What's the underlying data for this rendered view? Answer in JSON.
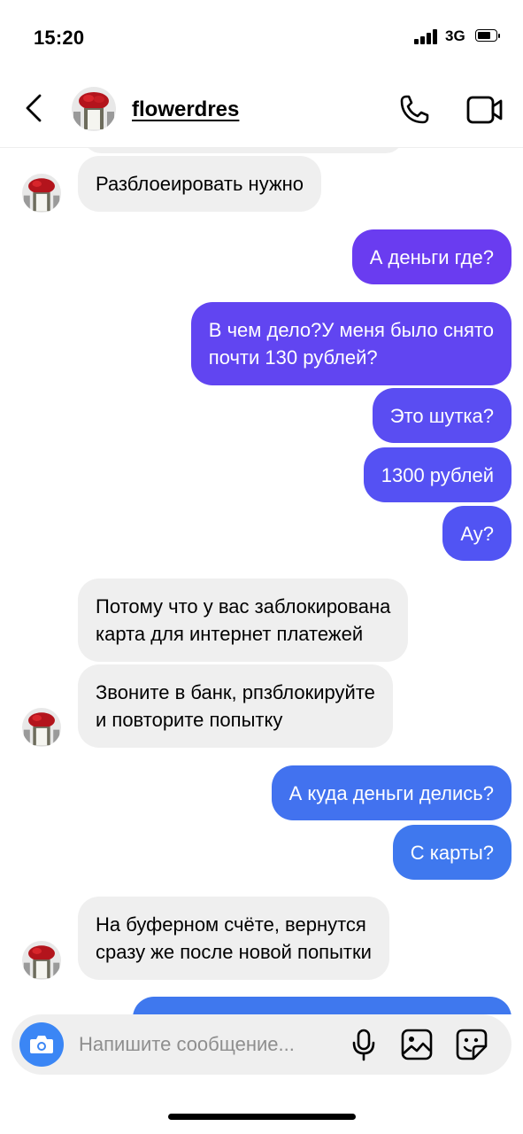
{
  "status_bar": {
    "time": "15:20",
    "network": "3G"
  },
  "header": {
    "username": "flowerdres"
  },
  "colors": {
    "sent_top": "#6a3cf0",
    "sent_mid": "#5150f3",
    "sent_bottom": "#3f78ee",
    "received": "#efefef",
    "camera": "#3b86f5"
  },
  "messages": [
    {
      "from": "them",
      "text": "Разблоеировать нужно"
    },
    {
      "from": "me",
      "text": "А деньги где?"
    },
    {
      "from": "me",
      "text": "В чем дело?У меня было снято\nпочти 130 рублей?"
    },
    {
      "from": "me",
      "text": "Это шутка?"
    },
    {
      "from": "me",
      "text": "1300 рублей"
    },
    {
      "from": "me",
      "text": "Ау?"
    },
    {
      "from": "them",
      "text": "Потому что у вас заблокирована\nкарта для интернет платежей"
    },
    {
      "from": "them",
      "text": "Звоните в банк, рпзблокируйте\nи повторите попытку"
    },
    {
      "from": "me",
      "text": "А куда деньги делись?"
    },
    {
      "from": "me",
      "text": "С карты?"
    },
    {
      "from": "them",
      "text": "На буферном счёте, вернутся\nсразу же после новой попытки"
    }
  ],
  "composer": {
    "placeholder": "Напишите сообщение..."
  }
}
